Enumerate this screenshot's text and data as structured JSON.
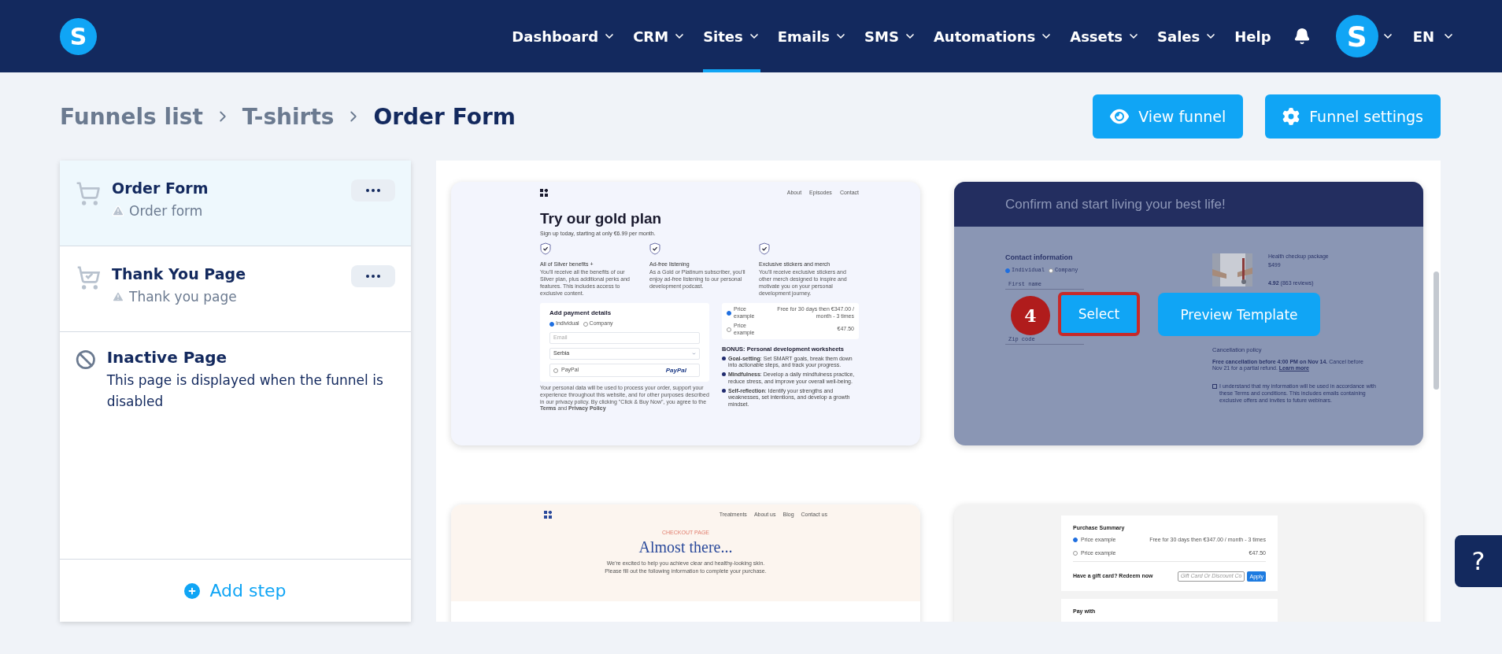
{
  "header": {
    "logo": "S",
    "nav": [
      {
        "label": "Dashboard",
        "dropdown": true,
        "selected": false
      },
      {
        "label": "CRM",
        "dropdown": true,
        "selected": false
      },
      {
        "label": "Sites",
        "dropdown": true,
        "selected": true
      },
      {
        "label": "Emails",
        "dropdown": true,
        "selected": false
      },
      {
        "label": "SMS",
        "dropdown": true,
        "selected": false
      },
      {
        "label": "Automations",
        "dropdown": true,
        "selected": false
      },
      {
        "label": "Assets",
        "dropdown": true,
        "selected": false
      },
      {
        "label": "Sales",
        "dropdown": true,
        "selected": false
      },
      {
        "label": "Help",
        "dropdown": false,
        "selected": false
      }
    ],
    "avatar": "S",
    "language": "EN"
  },
  "breadcrumb": [
    "Funnels list",
    "T-shirts",
    "Order Form"
  ],
  "actions": [
    "View funnel",
    "Funnel settings"
  ],
  "steps": [
    {
      "title": "Order Form",
      "subtitle": "Order form",
      "selected": true
    },
    {
      "title": "Thank You Page",
      "subtitle": "Thank you page",
      "selected": false
    }
  ],
  "inactive_page": {
    "title": "Inactive Page",
    "text": "This page is displayed when the funnel is disabled"
  },
  "add_step": "Add step",
  "templates": [
    {
      "kind": "gold",
      "nav": [
        "About",
        "Episodes",
        "Contact"
      ],
      "title": "Try our gold plan",
      "subtitle": "Sign up today, starting at only €6.99 per month.",
      "features": [
        {
          "title": "All of Silver benefits +",
          "text": "You'll receive all the benefits of our Silver plan, plus additional perks and features. This includes access to exclusive content."
        },
        {
          "title": "Ad-free listening",
          "text": "As a Gold or Platinum subscriber, you'll enjoy ad-free listening to our personal development podcast."
        },
        {
          "title": "Exclusive stickers and merch",
          "text": "You'll receive exclusive stickers and other merch designed to inspire and motivate you on your personal development journey."
        }
      ],
      "payment_title": "Add payment details",
      "options": [
        {
          "label": "Individual",
          "selected": true
        },
        {
          "label": "Company",
          "selected": false
        }
      ],
      "email_placeholder": "Email",
      "country": "Serbia",
      "paypal_label": "PayPal",
      "paypal_logo": "PayPal",
      "legal": "Your personal data will be used to process your order, support your experience throughout this website, and for other purposes described in our privacy policy. By clicking \"Click & Buy Now\", you agree to the **Terms** and **Privacy Policy**",
      "prices": [
        {
          "label": "Price example",
          "value": "Free for 30 days then €347.00 / month - 3 times",
          "selected": true
        },
        {
          "label": "Price example",
          "value": "€47.50",
          "selected": false
        }
      ],
      "bonus_title": "BONUS: Personal development worksheets",
      "bonus_items": [
        "**Goal-setting**: Set SMART goals, break them down into actionable steps, and track your progress.",
        "**Mindfulness**: Develop a daily mindfulness practice, reduce stress, and improve your overall well-being.",
        "**Self-reflection**: Identify your strengths and weaknesses, set intentions, and develop a growth mindset."
      ]
    },
    {
      "kind": "health",
      "title": "Confirm and start living your best life!",
      "contact_title": "Contact information",
      "options": [
        {
          "label": "Individual",
          "selected": true
        },
        {
          "label": "Company",
          "selected": false
        }
      ],
      "fields": [
        "First name",
        "Zip code"
      ],
      "product": "Health checkup package",
      "price": "$499",
      "rating": "**4.92** (863 reviews)",
      "policy_title": "Cancellation policy",
      "policy_text": "**Free cancellation before 4:00 PM on Nov 14.** Cancel before Nov 21 for a partial refund.",
      "policy_link": "Learn more",
      "consent_checked": false,
      "consent": "I understand that my information will be used in accordance with these Terms and conditions. This includes emails containing exclusive offers and invites to future webinars.",
      "step_marker": "4",
      "select": "Select",
      "select_highlighted": true,
      "preview": "Preview Template"
    },
    {
      "kind": "skin",
      "nav": [
        "Treatments",
        "About us",
        "Blog",
        "Contact us"
      ],
      "eyebrow": "CHECKOUT PAGE",
      "title": "Almost there...",
      "lines": [
        "We're excited to help you achieve clear and healthy-looking skin.",
        "Please fill out the following information to complete your purchase."
      ]
    },
    {
      "kind": "summary",
      "title": "Purchase Summary",
      "prices": [
        {
          "label": "Price example",
          "value": "Free for 30 days then €347.00 / month - 3 times",
          "selected": true
        },
        {
          "label": "Price example",
          "value": "€47.50",
          "selected": false
        }
      ],
      "gift_label": "Have a gift card? Redeem now",
      "gift_placeholder": "Gift Card Or Discount Co",
      "apply": "Apply",
      "pay_title": "Pay with"
    }
  ],
  "help": "?"
}
